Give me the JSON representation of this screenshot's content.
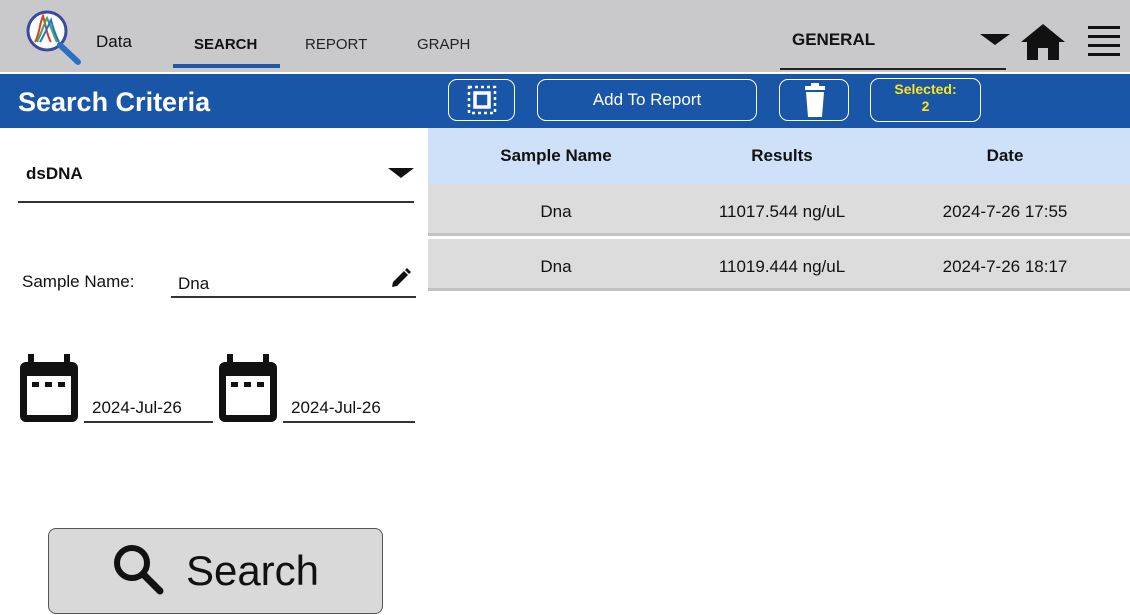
{
  "app": {
    "title": "Data",
    "tabs": [
      {
        "label": "SEARCH",
        "active": true
      },
      {
        "label": "REPORT",
        "active": false
      },
      {
        "label": "GRAPH",
        "active": false
      }
    ],
    "mode_selector": {
      "value": "GENERAL"
    },
    "icons": {
      "home": "home-icon",
      "menu": "hamburger-menu-icon",
      "logo": "magnifier-spectrum-logo"
    }
  },
  "header": {
    "title": "Search Criteria",
    "add_to_report_label": "Add To Report",
    "selected_label": "Selected:",
    "selected_count": "2",
    "colors": {
      "bar": "#1a56a8",
      "badge_text": "#ffe31a"
    }
  },
  "criteria": {
    "assay": "dsDNA",
    "sample_name_label": "Sample Name:",
    "sample_name_value": "Dna",
    "date_from": "2024-Jul-26",
    "date_to": "2024-Jul-26",
    "search_label": "Search"
  },
  "table": {
    "columns": [
      "Sample Name",
      "Results",
      "Date"
    ],
    "rows": [
      [
        "Dna",
        "11017.544 ng/uL",
        "2024-7-26 17:55"
      ],
      [
        "Dna",
        "11019.444 ng/uL",
        "2024-7-26 18:17"
      ]
    ]
  }
}
